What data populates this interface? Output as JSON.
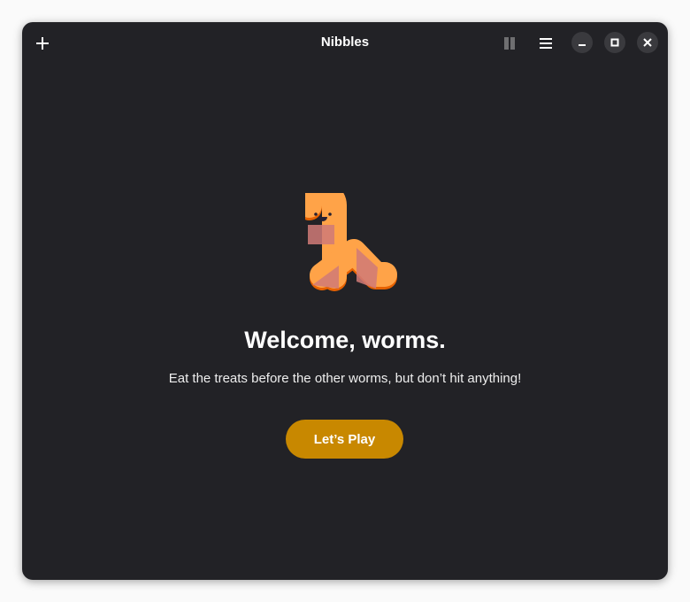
{
  "window": {
    "title": "Nibbles"
  },
  "header": {
    "new_game_icon": "plus-icon",
    "pause_icon": "pause-icon",
    "menu_icon": "hamburger-menu-icon",
    "minimize_icon": "minimize-icon",
    "maximize_icon": "maximize-icon",
    "close_icon": "close-icon"
  },
  "main": {
    "heading": "Welcome, worms.",
    "subtitle": "Eat the treats before the other worms, but don’t hit anything!",
    "play_label": "Let’s Play"
  },
  "colors": {
    "accent": "#c88800",
    "background": "#222226",
    "worm": "#ffa348",
    "stripe": "#d07a78"
  }
}
